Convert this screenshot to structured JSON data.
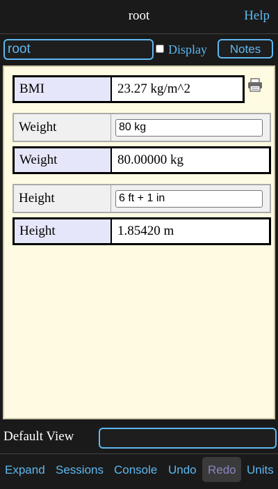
{
  "header": {
    "title": "root",
    "help_label": "Help"
  },
  "toolbar": {
    "name_value": "root",
    "display_label": "Display",
    "display_checked": false,
    "notes_label": "Notes"
  },
  "calc": {
    "bmi": {
      "label": "BMI",
      "value": "23.27 kg/m^2"
    },
    "weight_input": {
      "label": "Weight",
      "value": "80 kg"
    },
    "weight_result": {
      "label": "Weight",
      "value": "80.00000 kg"
    },
    "height_input": {
      "label": "Height",
      "value": "6 ft + 1 in"
    },
    "height_result": {
      "label": "Height",
      "value": "1.85420 m"
    }
  },
  "default_view": {
    "label": "Default View",
    "value": ""
  },
  "bottom": {
    "expand": "Expand",
    "sessions": "Sessions",
    "console": "Console",
    "undo": "Undo",
    "redo": "Redo",
    "units": "Units"
  },
  "colors": {
    "accent": "#5fb8f0",
    "panel_bg": "#fffbe2",
    "label_bg": "#e6e6fa",
    "disabled": "#8a86c0"
  },
  "icons": {
    "print": "printer-icon"
  }
}
